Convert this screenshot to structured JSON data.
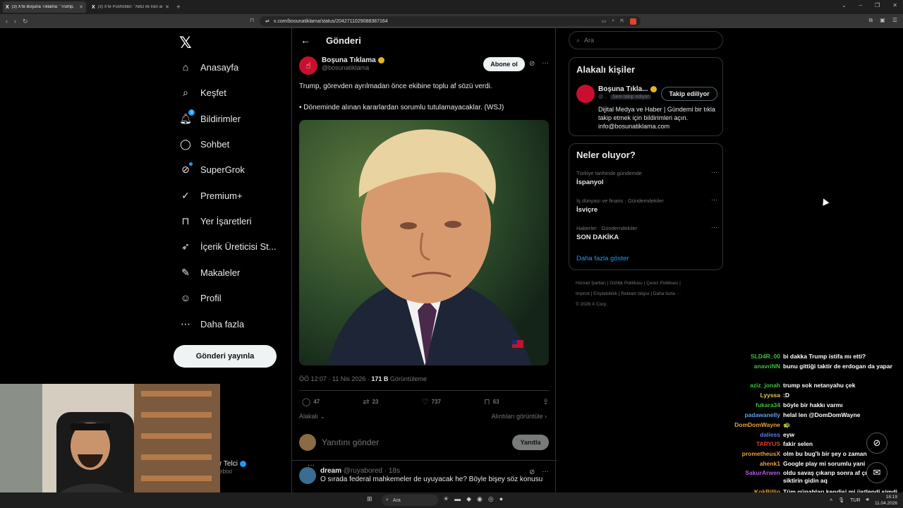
{
  "browser": {
    "tabs": [
      {
        "title": "(3) X'te Boşuna Tıklama: \"Trump,",
        "active": true
      },
      {
        "title": "(3) X'te Pusholder: \"ABD ile İran arası",
        "active": false
      }
    ],
    "url": "x.com/bosunatiklama/status/2042711029088387164"
  },
  "nav": {
    "items": [
      {
        "label": "Anasayfa",
        "icon": "home-icon"
      },
      {
        "label": "Keşfet",
        "icon": "search-icon"
      },
      {
        "label": "Bildirimler",
        "icon": "bell-icon",
        "badge": "3"
      },
      {
        "label": "Sohbet",
        "icon": "chat-icon"
      },
      {
        "label": "SuperGrok",
        "icon": "grok-icon"
      },
      {
        "label": "Premium+",
        "icon": "verified-icon"
      },
      {
        "label": "Yer İşaretleri",
        "icon": "bookmark-icon"
      },
      {
        "label": "İçerik Üreticisi St...",
        "icon": "rocket-icon"
      },
      {
        "label": "Makaleler",
        "icon": "article-icon"
      },
      {
        "label": "Profil",
        "icon": "person-icon"
      },
      {
        "label": "Daha fazla",
        "icon": "more-circle-icon"
      }
    ],
    "post_button": "Gönderi yayınla",
    "account_name": "lır Telci",
    "account_handle": "kebixi"
  },
  "post": {
    "header_title": "Gönderi",
    "author_name": "Boşuna Tıklama",
    "author_handle": "@bosunatiklama",
    "subscribe_label": "Abone ol",
    "text_line1": "Trump, görevden ayrılmadan önce ekibine toplu af sözü verdi.",
    "text_line2": "• Döneminde alınan kararlardan sorumlu tutulamayacaklar. (WSJ)",
    "time": "ÖÖ 12:07 · 11 Nis 2026 · ",
    "views_count": "171 B",
    "views_label": " Görüntüleme",
    "replies": "47",
    "reposts": "23",
    "likes": "737",
    "bookmarks": "63",
    "relevant_label": "Alakalı",
    "quotes_label": "Alıntıları görüntüle",
    "reply_placeholder": "Yanıtını gönder",
    "reply_button": "Yanıtla"
  },
  "reply": {
    "name": "dream",
    "handle": "@ruyabored · 18s",
    "text": "O sırada federal mahkemeler de uyuyacak he? Böyle bişey söz konusu"
  },
  "sidebar": {
    "search_placeholder": "Ara",
    "relevant_title": "Alakalı kişiler",
    "who_name": "Boşuna Tıkla...",
    "who_handle": "@...",
    "follows_you": "Seni takip ediyor",
    "following_label": "Takip ediliyor",
    "who_bio": "Dijital Medya ve Haber | Gündemi bir tıkla takip etmek için bildirimleri açın. info@bosunatiklama.com",
    "trends_title": "Neler oluyor?",
    "trends": [
      {
        "meta": "Türkiye tarihinde gündemde",
        "name": "İspanyol"
      },
      {
        "meta": "İş dünyası ve finans · Gündemdekiler",
        "name": "İsviçre"
      },
      {
        "meta": "Haberler · Gündemdekiler",
        "name": "SON DAKİKA"
      }
    ],
    "show_more": "Daha fazla göster",
    "footer_line1": "Hizmet Şartları  |  Gizlilik Politikası  |  Çerez Politikası  |",
    "footer_line2": "Imprint  |  Erişilebilirlik  |  Reklam bilgisi  |  Daha fazla ···",
    "footer_line3": "© 2026 X Corp."
  },
  "chat": [
    {
      "user": "SLD4R_00",
      "msg": "bi dakka Trump istifa mı etti?",
      "color": "#3fbf3f"
    },
    {
      "user": "anavriNN",
      "msg": "bunu gittiği taktir de erdogan da yapar",
      "color": "#3fbf3f"
    },
    {
      "user": "aziz_jonah",
      "msg": "trump sok netanyahu çek",
      "color": "#3fbf3f"
    },
    {
      "user": "Lyyssa",
      "msg": ":D",
      "color": "#e6c84a"
    },
    {
      "user": "fukara34",
      "msg": "böyle bir hakkı varmı",
      "color": "#3fbf3f"
    },
    {
      "user": "padawanelly",
      "msg": "helal len @DomDomWayne",
      "color": "#5aa0e6"
    },
    {
      "user": "DomDomWayne",
      "msg": "",
      "color": "#e6a23c"
    },
    {
      "user": "daliess",
      "msg": "eyw",
      "color": "#5a7be6"
    },
    {
      "user": "TARYUS",
      "msg": "fakir selen",
      "color": "#e03a3a"
    },
    {
      "user": "prometheusX",
      "msg": "olm bu bug'lı bir şey o zaman",
      "color": "#e6a23c"
    },
    {
      "user": "ahenk1",
      "msg": "Google play mi sorumlu yani",
      "color": "#e6a23c"
    },
    {
      "user": "SakurArwen",
      "msg": "oldu savaş çıkarıp sonra af çıkarılsın siktirin gidin aq",
      "color": "#b45ae6"
    },
    {
      "user": "KokBillig",
      "msg": "Tüm günahları kendisi mi üstlendi şimdi",
      "color": "#e6a23c"
    }
  ],
  "taskbar": {
    "search": "Ara",
    "lang": "TUR",
    "time": "18:19",
    "date": "11.04.2026"
  }
}
